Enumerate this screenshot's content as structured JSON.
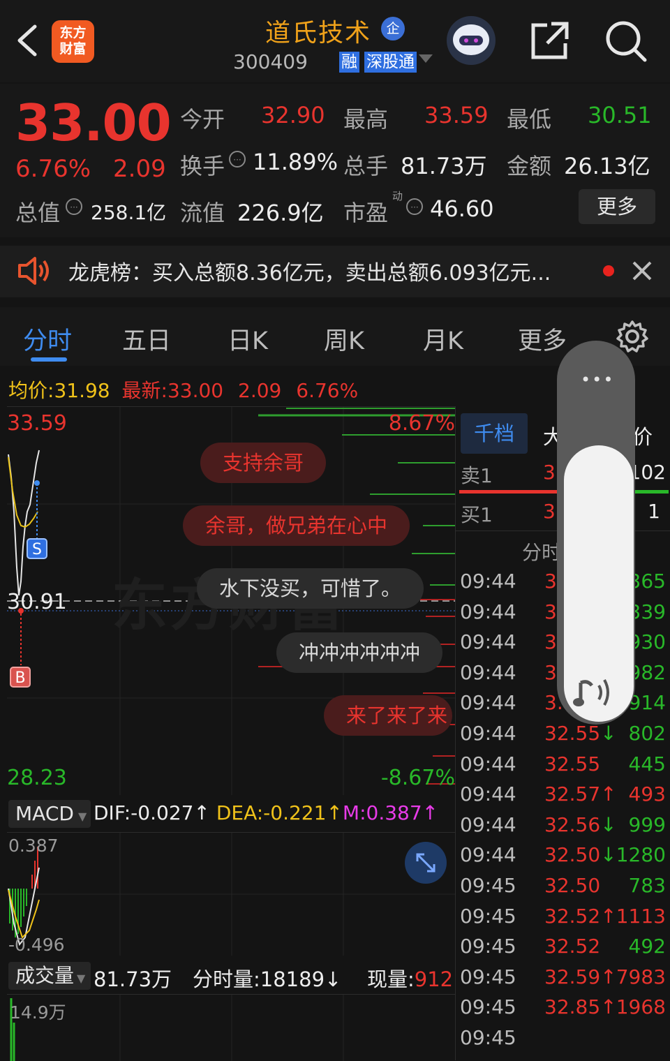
{
  "header": {
    "logo_line1": "东方",
    "logo_line2": "财富",
    "stock_name": "道氏技术",
    "corp_badge": "企",
    "stock_code": "300409",
    "tag_margin": "融",
    "tag_connect": "深股通"
  },
  "quote": {
    "price": "33.00",
    "change_pct": "6.76%",
    "change_abs": "2.09",
    "open_label": "今开",
    "open_value": "32.90",
    "high_label": "最高",
    "high_value": "33.59",
    "low_label": "最低",
    "low_value": "30.51",
    "turnover_label": "换手",
    "turnover_value": "11.89%",
    "volume_label": "总手",
    "volume_value": "81.73万",
    "amount_label": "金额",
    "amount_value": "26.13亿",
    "mcap_label": "总值",
    "mcap_value": "258.1亿",
    "float_label": "流值",
    "float_value": "226.9亿",
    "pe_label": "市盈",
    "pe_superscript": "动",
    "pe_value": "46.60",
    "more_label": "更多"
  },
  "notice": {
    "text": "龙虎榜：买入总额8.36亿元，卖出总额6.093亿元..."
  },
  "tabs": [
    {
      "label": "分时"
    },
    {
      "label": "五日"
    },
    {
      "label": "日K"
    },
    {
      "label": "周K"
    },
    {
      "label": "月K"
    },
    {
      "label": "更多"
    }
  ],
  "avg_bar": {
    "avg_label": "均价:",
    "avg_value": "31.98",
    "latest_label": "最新:",
    "latest_value": "33.00",
    "change_abs": "2.09",
    "change_pct": "6.76%"
  },
  "chart": {
    "y_top": "33.59",
    "pct_top": "8.67%",
    "y_mid": "30.91",
    "y_bottom": "28.23",
    "pct_bottom": "-8.67%",
    "marker_s": "S",
    "marker_b": "B",
    "watermark": "东方财富"
  },
  "comments": [
    "支持余哥",
    "余哥，做兄弟在心中",
    "水下没买，可惜了。",
    "冲冲冲冲冲冲",
    "来了来了来"
  ],
  "macd": {
    "selector": "MACD",
    "dif": "DIF:-0.027",
    "dea": "DEA:-0.221",
    "m": "M:0.387",
    "top": "0.387",
    "bottom": "-0.496"
  },
  "volume": {
    "selector": "成交量",
    "total": "81.73万",
    "period_label": "分时量:18189",
    "current_label": "现量:",
    "current_value": "912",
    "axis_top": "14.9万"
  },
  "order_book": {
    "tab_active": "千档",
    "tab_next": "大",
    "tab_price": "价",
    "sell1_label": "卖1",
    "sell1_price": "3",
    "sell1_vol": "102",
    "buy1_label": "买1",
    "buy1_price": "3",
    "buy1_vol": "1",
    "ticks_label": "分时"
  },
  "ticks": [
    {
      "time": "09:44",
      "price": "3",
      "vol": "365",
      "arrow": ""
    },
    {
      "time": "09:44",
      "price": "3",
      "vol": "339",
      "arrow": ""
    },
    {
      "time": "09:44",
      "price": "3",
      "vol": "930",
      "arrow": ""
    },
    {
      "time": "09:44",
      "price": "3",
      "vol": "982",
      "arrow": ""
    },
    {
      "time": "09:44",
      "price": "3.",
      "vol": "914",
      "arrow": ""
    },
    {
      "time": "09:44",
      "price": "32.55",
      "vol": "802",
      "arrow": "↓"
    },
    {
      "time": "09:44",
      "price": "32.55",
      "vol": "445",
      "arrow": ""
    },
    {
      "time": "09:44",
      "price": "32.57",
      "vol": "493",
      "arrow": "↑"
    },
    {
      "time": "09:44",
      "price": "32.56",
      "vol": "999",
      "arrow": "↓"
    },
    {
      "time": "09:44",
      "price": "32.50",
      "vol": "1280",
      "arrow": "↓"
    },
    {
      "time": "09:45",
      "price": "32.50",
      "vol": "783",
      "arrow": ""
    },
    {
      "time": "09:45",
      "price": "32.52",
      "vol": "1113",
      "arrow": "↑"
    },
    {
      "time": "09:45",
      "price": "32.52",
      "vol": "492",
      "arrow": ""
    },
    {
      "time": "09:45",
      "price": "32.59",
      "vol": "7983",
      "arrow": "↑"
    },
    {
      "time": "09:45",
      "price": "32.85",
      "vol": "1968",
      "arrow": "↑"
    },
    {
      "time": "09:45",
      "price": "",
      "vol": "",
      "arrow": ""
    }
  ],
  "float_control": {
    "menu": "•••"
  },
  "colors": {
    "up": "#e8342e",
    "down": "#29b829",
    "accent": "#3f8cf0",
    "name": "#f0a21a"
  }
}
